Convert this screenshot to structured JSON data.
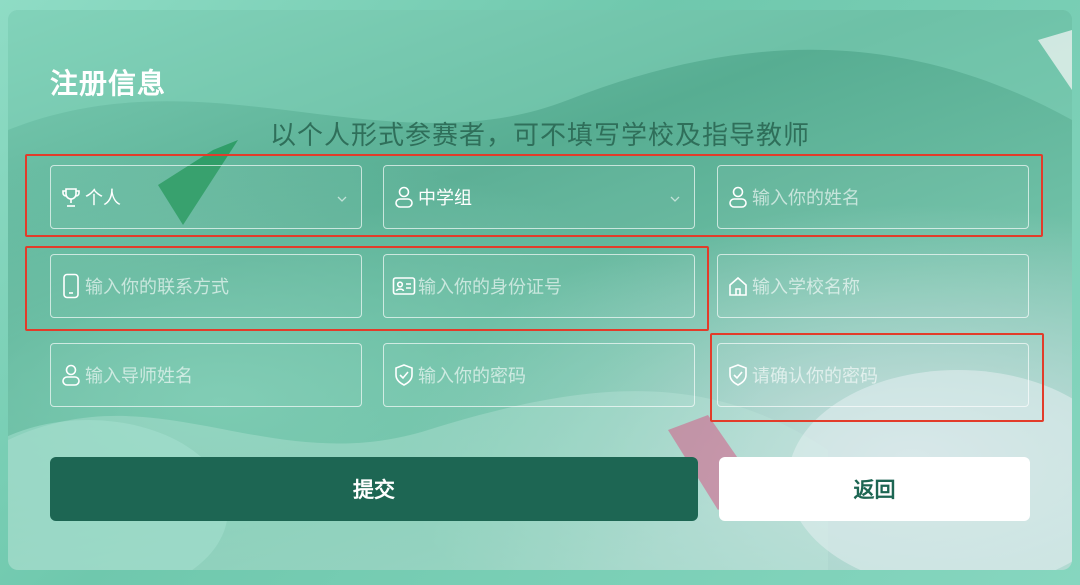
{
  "form": {
    "title": "注册信息",
    "subtitle": "以个人形式参赛者，可不填写学校及指导教师",
    "participant_type": {
      "value": "个人",
      "icon": "trophy-icon"
    },
    "group": {
      "value": "中学组",
      "icon": "user-icon"
    },
    "name": {
      "placeholder": "输入你的姓名",
      "icon": "user-icon"
    },
    "phone": {
      "placeholder": "输入你的联系方式",
      "icon": "phone-icon"
    },
    "id_number": {
      "placeholder": "输入你的身份证号",
      "icon": "id-card-icon"
    },
    "school": {
      "placeholder": "输入学校名称",
      "icon": "home-icon"
    },
    "teacher": {
      "placeholder": "输入导师姓名",
      "icon": "user-icon"
    },
    "password": {
      "placeholder": "输入你的密码",
      "icon": "shield-check-icon"
    },
    "confirm_password": {
      "placeholder": "请确认你的密码",
      "icon": "shield-check-icon"
    },
    "submit_label": "提交",
    "back_label": "返回"
  },
  "colors": {
    "primary": "#1d6653",
    "highlight": "#e23c2a",
    "subtitle": "#2f6f5a"
  }
}
